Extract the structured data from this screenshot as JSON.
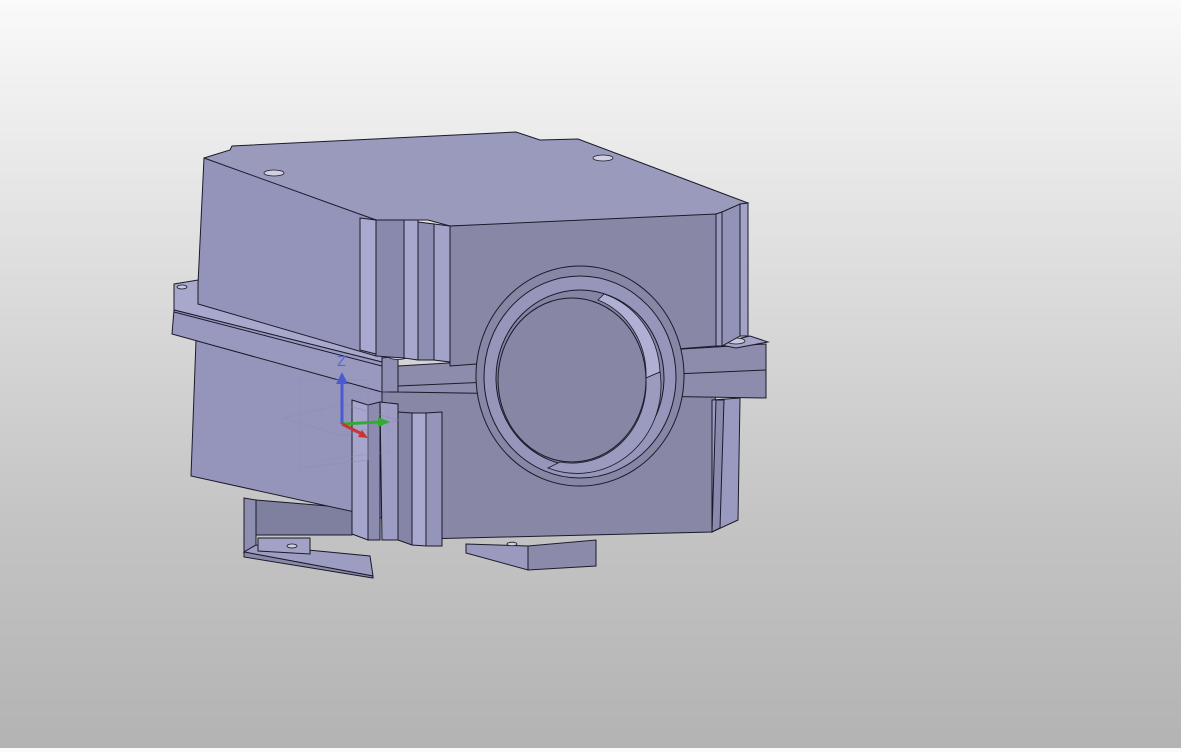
{
  "viewport": {
    "background_top": "#f6f6f6",
    "background_bottom": "#b3b3b3"
  },
  "model": {
    "name": "pillow-block-housing-part",
    "body_color_top": "#9c9cbc",
    "body_color_left": "#9a9ac0",
    "body_color_front": "#8b8aaa",
    "edge_color": "#1a1a2a",
    "visible_holes": 4,
    "bore_count": 1
  },
  "triad": {
    "z_label": "Z",
    "colors": {
      "x": "#cc3333",
      "y": "#33aa33",
      "z": "#4a5bd0"
    }
  },
  "icons": [
    "axis-triad-icon"
  ]
}
